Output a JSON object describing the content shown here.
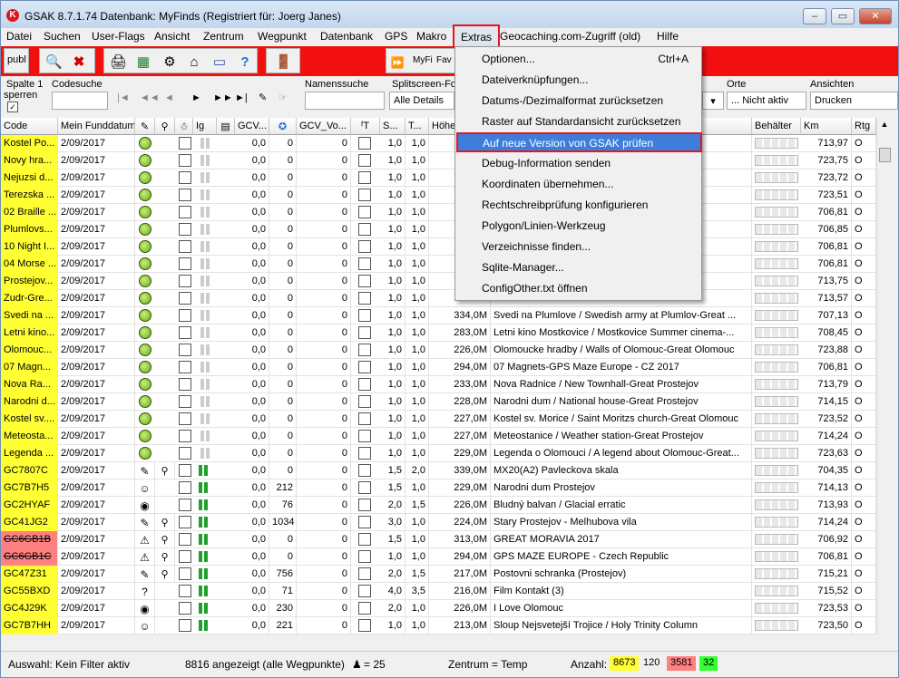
{
  "window": {
    "title": "GSAK 8.7.1.74     Datenbank: MyFinds     (Registriert für: Joerg Janes)",
    "controls": {
      "minimize": "‒",
      "maximize": "▭",
      "close": "✕"
    }
  },
  "menubar": [
    "Datei",
    "Suchen",
    "User-Flags",
    "Ansicht",
    "Zentrum",
    "Wegpunkt",
    "Datenbank",
    "GPS",
    "Makro",
    "Extras",
    "Geocaching.com-Zugriff (old)",
    "Hilfe"
  ],
  "toolbar": {
    "publ_label": "publ",
    "myfi": "MyFi",
    "fav": "Fav"
  },
  "filters": {
    "spalte": "Spalte 1",
    "sperren": "sperren",
    "codesuche": "Codesuche",
    "namenssuche": "Namenssuche",
    "splitscreen": "Splitscreen-For",
    "alle_details": "Alle Details",
    "orte": "Orte",
    "orte_value": "... Nicht aktiv",
    "ansichten": "Ansichten",
    "ansichten_value": "Drucken"
  },
  "columns": [
    "Code",
    "Mein Funddatum",
    "",
    "",
    "",
    "Ig",
    "",
    "GCV...",
    "",
    "GCV_Vo...",
    "",
    "S...",
    "T...",
    "Höhe",
    "",
    "Behälter",
    "Km",
    "Rtg"
  ],
  "rows": [
    {
      "code": "Kostel Po...",
      "date": "2/09/2017",
      "gcv": "0,0",
      "a": "0",
      "b": "0",
      "s": "1,0",
      "t": "1,0",
      "h": "",
      "name": "Great Pr...",
      "km": "713,97",
      "rtg": "O",
      "hl": "y",
      "icon": "g"
    },
    {
      "code": "Novy hra...",
      "date": "2/09/2017",
      "gcv": "0,0",
      "a": "0",
      "b": "0",
      "s": "1,0",
      "t": "1,0",
      "h": "",
      "name": "",
      "km": "723,75",
      "rtg": "O",
      "hl": "y",
      "icon": "g"
    },
    {
      "code": "Nejuzsi d...",
      "date": "2/09/2017",
      "gcv": "0,0",
      "a": "0",
      "b": "0",
      "s": "1,0",
      "t": "1,0",
      "h": "",
      "name": "c-Great...",
      "km": "723,72",
      "rtg": "O",
      "hl": "y",
      "icon": "g"
    },
    {
      "code": "Terezska ...",
      "date": "2/09/2017",
      "gcv": "0,0",
      "a": "0",
      "b": "0",
      "s": "1,0",
      "t": "1,0",
      "h": "",
      "name": "ouc",
      "km": "723,51",
      "rtg": "O",
      "hl": "y",
      "icon": "g"
    },
    {
      "code": "02 Braille ...",
      "date": "2/09/2017",
      "gcv": "0,0",
      "a": "0",
      "b": "0",
      "s": "1,0",
      "t": "1,0",
      "h": "",
      "name": "",
      "km": "706,81",
      "rtg": "O",
      "hl": "y",
      "icon": "g"
    },
    {
      "code": "Plumlovs...",
      "date": "2/09/2017",
      "gcv": "0,0",
      "a": "0",
      "b": "0",
      "s": "1,0",
      "t": "1,0",
      "h": "",
      "name": "mlov",
      "km": "706,85",
      "rtg": "O",
      "hl": "y",
      "icon": "g"
    },
    {
      "code": "10 Night I...",
      "date": "2/09/2017",
      "gcv": "0,0",
      "a": "0",
      "b": "0",
      "s": "1,0",
      "t": "1,0",
      "h": "",
      "name": "",
      "km": "706,81",
      "rtg": "O",
      "hl": "y",
      "icon": "g"
    },
    {
      "code": "04 Morse ...",
      "date": "2/09/2017",
      "gcv": "0,0",
      "a": "0",
      "b": "0",
      "s": "1,0",
      "t": "1,0",
      "h": "",
      "name": "7",
      "km": "706,81",
      "rtg": "O",
      "hl": "y",
      "icon": "g"
    },
    {
      "code": "Prostejov...",
      "date": "2/09/2017",
      "gcv": "0,0",
      "a": "0",
      "b": "0",
      "s": "1,0",
      "t": "1,0",
      "h": "",
      "name": "Prostejov",
      "km": "713,75",
      "rtg": "O",
      "hl": "y",
      "icon": "g"
    },
    {
      "code": "Zudr-Gre...",
      "date": "2/09/2017",
      "gcv": "0,0",
      "a": "0",
      "b": "0",
      "s": "1,0",
      "t": "1,0",
      "h": "",
      "name": "",
      "km": "713,57",
      "rtg": "O",
      "hl": "y",
      "icon": "g"
    },
    {
      "code": "Svedi na ...",
      "date": "2/09/2017",
      "gcv": "0,0",
      "a": "0",
      "b": "0",
      "s": "1,0",
      "t": "1,0",
      "h": "334,0M",
      "name": "Svedi na Plumlove / Swedish army at Plumlov-Great ...",
      "km": "707,13",
      "rtg": "O",
      "hl": "y",
      "icon": "g"
    },
    {
      "code": "Letni kino...",
      "date": "2/09/2017",
      "gcv": "0,0",
      "a": "0",
      "b": "0",
      "s": "1,0",
      "t": "1,0",
      "h": "283,0M",
      "name": "Letni kino Mostkovice / Mostkovice Summer cinema-...",
      "km": "708,45",
      "rtg": "O",
      "hl": "y",
      "icon": "g"
    },
    {
      "code": "Olomouc...",
      "date": "2/09/2017",
      "gcv": "0,0",
      "a": "0",
      "b": "0",
      "s": "1,0",
      "t": "1,0",
      "h": "226,0M",
      "name": "Olomoucke hradby / Walls of Olomouc-Great Olomouc",
      "km": "723,88",
      "rtg": "O",
      "hl": "y",
      "icon": "g"
    },
    {
      "code": "07 Magn...",
      "date": "2/09/2017",
      "gcv": "0,0",
      "a": "0",
      "b": "0",
      "s": "1,0",
      "t": "1,0",
      "h": "294,0M",
      "name": "07 Magnets-GPS Maze Europe - CZ 2017",
      "km": "706,81",
      "rtg": "O",
      "hl": "y",
      "icon": "g"
    },
    {
      "code": "Nova Ra...",
      "date": "2/09/2017",
      "gcv": "0,0",
      "a": "0",
      "b": "0",
      "s": "1,0",
      "t": "1,0",
      "h": "233,0M",
      "name": "Nova Radnice / New Townhall-Great Prostejov",
      "km": "713,79",
      "rtg": "O",
      "hl": "y",
      "icon": "g"
    },
    {
      "code": "Narodni d...",
      "date": "2/09/2017",
      "gcv": "0,0",
      "a": "0",
      "b": "0",
      "s": "1,0",
      "t": "1,0",
      "h": "228,0M",
      "name": "Narodni dum / National house-Great Prostejov",
      "km": "714,15",
      "rtg": "O",
      "hl": "y",
      "icon": "g"
    },
    {
      "code": "Kostel sv....",
      "date": "2/09/2017",
      "gcv": "0,0",
      "a": "0",
      "b": "0",
      "s": "1,0",
      "t": "1,0",
      "h": "227,0M",
      "name": "Kostel sv. Morice / Saint Moritzs church-Great Olomouc",
      "km": "723,52",
      "rtg": "O",
      "hl": "y",
      "icon": "g"
    },
    {
      "code": "Meteosta...",
      "date": "2/09/2017",
      "gcv": "0,0",
      "a": "0",
      "b": "0",
      "s": "1,0",
      "t": "1,0",
      "h": "227,0M",
      "name": "Meteostanice / Weather station-Great Prostejov",
      "km": "714,24",
      "rtg": "O",
      "hl": "y",
      "icon": "g"
    },
    {
      "code": "Legenda ...",
      "date": "2/09/2017",
      "gcv": "0,0",
      "a": "0",
      "b": "0",
      "s": "1,0",
      "t": "1,0",
      "h": "229,0M",
      "name": "Legenda o Olomouci / A legend about Olomouc-Great...",
      "km": "723,63",
      "rtg": "O",
      "hl": "y",
      "icon": "g"
    },
    {
      "code": "GC7807C",
      "date": "2/09/2017",
      "gcv": "0,0",
      "a": "0",
      "b": "0",
      "s": "1,5",
      "t": "2,0",
      "h": "339,0M",
      "name": "MX20(A2) Pavleckova skala",
      "km": "704,35",
      "rtg": "O",
      "hl": "y",
      "icon": "m"
    },
    {
      "code": "GC7B7H5",
      "date": "2/09/2017",
      "gcv": "0,0",
      "a": "212",
      "b": "0",
      "s": "1,5",
      "t": "1,0",
      "h": "229,0M",
      "name": "Narodni dum Prostejov",
      "km": "714,13",
      "rtg": "O",
      "hl": "y",
      "icon": "w"
    },
    {
      "code": "GC2HYAF",
      "date": "2/09/2017",
      "gcv": "0,0",
      "a": "76",
      "b": "0",
      "s": "2,0",
      "t": "1,5",
      "h": "226,0M",
      "name": "Bludný balvan / Glacial erratic",
      "km": "713,93",
      "rtg": "O",
      "hl": "y",
      "icon": "e"
    },
    {
      "code": "GC41JG2",
      "date": "2/09/2017",
      "gcv": "0,0",
      "a": "1034",
      "b": "0",
      "s": "3,0",
      "t": "1,0",
      "h": "224,0M",
      "name": "Stary Prostejov - Melhubova vila",
      "km": "714,24",
      "rtg": "O",
      "hl": "y",
      "icon": "m"
    },
    {
      "code": "GC6GB1B",
      "date": "2/09/2017",
      "gcv": "0,0",
      "a": "0",
      "b": "0",
      "s": "1,5",
      "t": "1,0",
      "h": "313,0M",
      "name": "GREAT MORAVIA 2017",
      "km": "706,92",
      "rtg": "O",
      "hl": "r",
      "icon": "p"
    },
    {
      "code": "GC6GB1C",
      "date": "2/09/2017",
      "gcv": "0,0",
      "a": "0",
      "b": "0",
      "s": "1,0",
      "t": "1,0",
      "h": "294,0M",
      "name": "GPS MAZE EUROPE - Czech Republic",
      "km": "706,81",
      "rtg": "O",
      "hl": "r",
      "icon": "p"
    },
    {
      "code": "GC47Z31",
      "date": "2/09/2017",
      "gcv": "0,0",
      "a": "756",
      "b": "0",
      "s": "2,0",
      "t": "1,5",
      "h": "217,0M",
      "name": "Postovni schranka (Prostejov)",
      "km": "715,21",
      "rtg": "O",
      "hl": "y",
      "icon": "m"
    },
    {
      "code": "GC55BXD",
      "date": "2/09/2017",
      "gcv": "0,0",
      "a": "71",
      "b": "0",
      "s": "4,0",
      "t": "3,5",
      "h": "216,0M",
      "name": "Film Kontakt (3)",
      "km": "715,52",
      "rtg": "O",
      "hl": "y",
      "icon": "q"
    },
    {
      "code": "GC4J29K",
      "date": "2/09/2017",
      "gcv": "0,0",
      "a": "230",
      "b": "0",
      "s": "2,0",
      "t": "1,0",
      "h": "226,0M",
      "name": "I Love Olomouc",
      "km": "723,53",
      "rtg": "O",
      "hl": "y",
      "icon": "b"
    },
    {
      "code": "GC7B7HH",
      "date": "2/09/2017",
      "gcv": "0,0",
      "a": "221",
      "b": "0",
      "s": "1,0",
      "t": "1,0",
      "h": "213,0M",
      "name": "Sloup Nejsvetejší Trojice / Holy Trinity Column",
      "km": "723,50",
      "rtg": "O",
      "hl": "y",
      "icon": "w"
    }
  ],
  "dropdown": {
    "items": [
      {
        "label": "Optionen...",
        "shortcut": "Ctrl+A"
      },
      {
        "label": "Dateiverknüpfungen...",
        "shortcut": ""
      },
      {
        "label": "Datums-/Dezimalformat zurücksetzen",
        "shortcut": ""
      },
      {
        "label": "Raster auf Standardansicht zurücksetzen",
        "shortcut": ""
      },
      {
        "label": "Auf neue Version von GSAK prüfen",
        "shortcut": ""
      },
      {
        "label": "Debug-Information senden",
        "shortcut": ""
      },
      {
        "label": "Koordinaten übernehmen...",
        "shortcut": ""
      },
      {
        "label": "Rechtschreibprüfung konfigurieren",
        "shortcut": ""
      },
      {
        "label": "Polygon/Linien-Werkzeug",
        "shortcut": ""
      },
      {
        "label": "Verzeichnisse finden...",
        "shortcut": ""
      },
      {
        "label": "Sqlite-Manager...",
        "shortcut": ""
      },
      {
        "label": "ConfigOther.txt öffnen",
        "shortcut": ""
      }
    ]
  },
  "status": {
    "auswahl": "Auswahl: Kein Filter aktiv",
    "count": "8816 angezeigt (alle Wegpunkte)",
    "person": "= 25",
    "zentrum": "Zentrum = Temp",
    "anzahl": "Anzahl:",
    "b1": "8673",
    "b2": "120",
    "b3": "3581",
    "b4": "32"
  },
  "colors": {
    "accent_red": "#f20f0f",
    "highlight_yellow": "#ffff33",
    "highlight_red": "#ff8080",
    "menu_selected": "#3d7edb",
    "badge_yellow": "#ffff33",
    "badge_red": "#ff8080",
    "badge_green": "#33ff33"
  }
}
